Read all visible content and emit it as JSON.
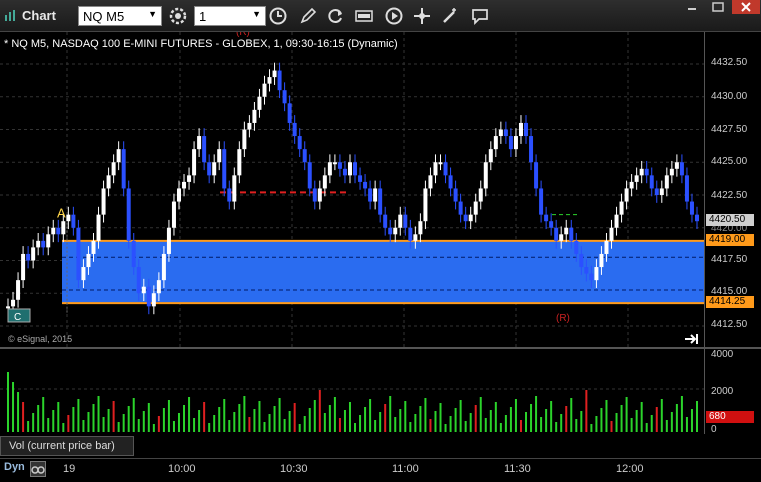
{
  "app": {
    "title": "Chart",
    "symbol": "NQ M5",
    "interval": "1"
  },
  "toolbar": {
    "icons": [
      "settings-icon",
      "clock-icon",
      "pencil-icon",
      "refresh-icon",
      "quote-icon",
      "play-icon",
      "cursor-move-icon",
      "comment-icon"
    ]
  },
  "chart": {
    "title": "* NQ M5, NASDAQ 100 E-MINI FUTURES - GLOBEX, 1, 09:30-16:15 (Dynamic)",
    "copyright": "© eSignal, 2015",
    "price_ticks": [
      "4432.50",
      "4430.00",
      "4427.50",
      "4425.00",
      "4422.50",
      "4420.00",
      "4417.50",
      "4415.00",
      "4412.50"
    ],
    "price_tags": {
      "last": "4420.50",
      "upper": "4419.00",
      "lower": "4414.25"
    },
    "markers": {
      "a": "A",
      "r_top": "(R)",
      "r_bottom": "(R)",
      "c_box": "C"
    }
  },
  "volume": {
    "label": "Vol (current price bar)",
    "ticks": [
      "4000",
      "2000",
      "0"
    ],
    "current": "680"
  },
  "xaxis": {
    "dyn": "Dyn",
    "times": [
      "19",
      "10:00",
      "10:30",
      "11:00",
      "11:30",
      "12:00"
    ]
  },
  "colors": {
    "band": "#2a6cf0",
    "band_border": "#ff9a1a",
    "up": "#ffffff",
    "down": "#2b50ff",
    "volume": "#2bd42b",
    "volume_red": "#e02020",
    "tag_orange": "#ff9a1a",
    "tag_grey": "#cfcfcf",
    "tag_red": "#d01010"
  },
  "chart_data": {
    "type": "bar",
    "series": [
      {
        "values": [
          4414,
          4414.5,
          4416,
          4418,
          4417.5,
          4418.5,
          4419,
          4418.5,
          4419.5,
          4420,
          4419.5,
          4420.5,
          4421,
          4420,
          4416,
          4417,
          4418,
          4419,
          4421,
          4423,
          4424,
          4425,
          4426,
          4423,
          4419,
          4417,
          4415,
          4415.5,
          4414,
          4415,
          4416,
          4418,
          4420,
          4422,
          4423,
          4423.5,
          4424,
          4426,
          4427,
          4425,
          4424,
          4425,
          4426,
          4423,
          4422,
          4424,
          4426,
          4427.5,
          4428,
          4429,
          4430,
          4431,
          4431.5,
          4432,
          4430.5,
          4429.5,
          4428,
          4427,
          4426,
          4425,
          4423,
          4422,
          4423,
          4424,
          4425,
          4425,
          4424.5,
          4424,
          4425,
          4424,
          4423.5,
          4423,
          4422,
          4423,
          4421,
          4420,
          4419.5,
          4420,
          4421,
          4420,
          4419,
          4419.5,
          4420.5,
          4423,
          4424,
          4425,
          4425,
          4424,
          4423,
          4422,
          4421,
          4420.5,
          4421,
          4422,
          4423,
          4425,
          4426,
          4427,
          4427.5,
          4427,
          4426,
          4427,
          4428,
          4427,
          4425,
          4423,
          4421,
          4420.5,
          4420,
          4419,
          4419.5,
          4420,
          4419,
          4418,
          4417,
          4416.5,
          4416,
          4417,
          4418,
          4419,
          4420,
          4421,
          4422,
          4423,
          4423.5,
          4424,
          4424.5,
          4424,
          4423,
          4422.5,
          4423,
          4424,
          4424.5,
          4425,
          4424,
          4422,
          4421,
          4420.5
        ]
      }
    ]
  }
}
